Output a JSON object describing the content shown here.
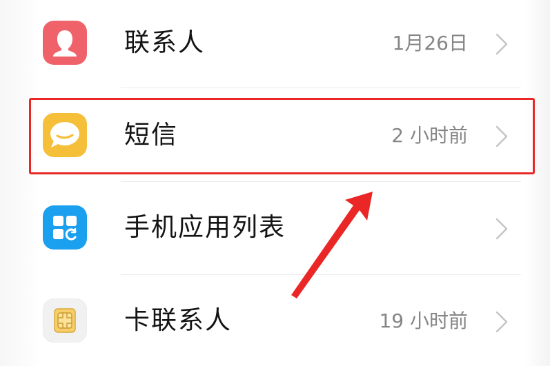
{
  "list": {
    "items": [
      {
        "label": "联系人",
        "meta": "1月26日",
        "icon": "contact-person-icon",
        "icon_color": "#f0626a"
      },
      {
        "label": "短信",
        "meta": "2 小时前",
        "icon": "message-bubble-icon",
        "icon_color": "#f6bf3a"
      },
      {
        "label": "手机应用列表",
        "meta": "",
        "icon": "app-grid-icon",
        "icon_color": "#1aa0ee"
      },
      {
        "label": "卡联系人",
        "meta": "19 小时前",
        "icon": "sim-card-icon",
        "icon_color": "#f1f1f1"
      }
    ]
  },
  "annotation": {
    "highlight_color": "#ea2626",
    "highlighted_item": "短信"
  }
}
